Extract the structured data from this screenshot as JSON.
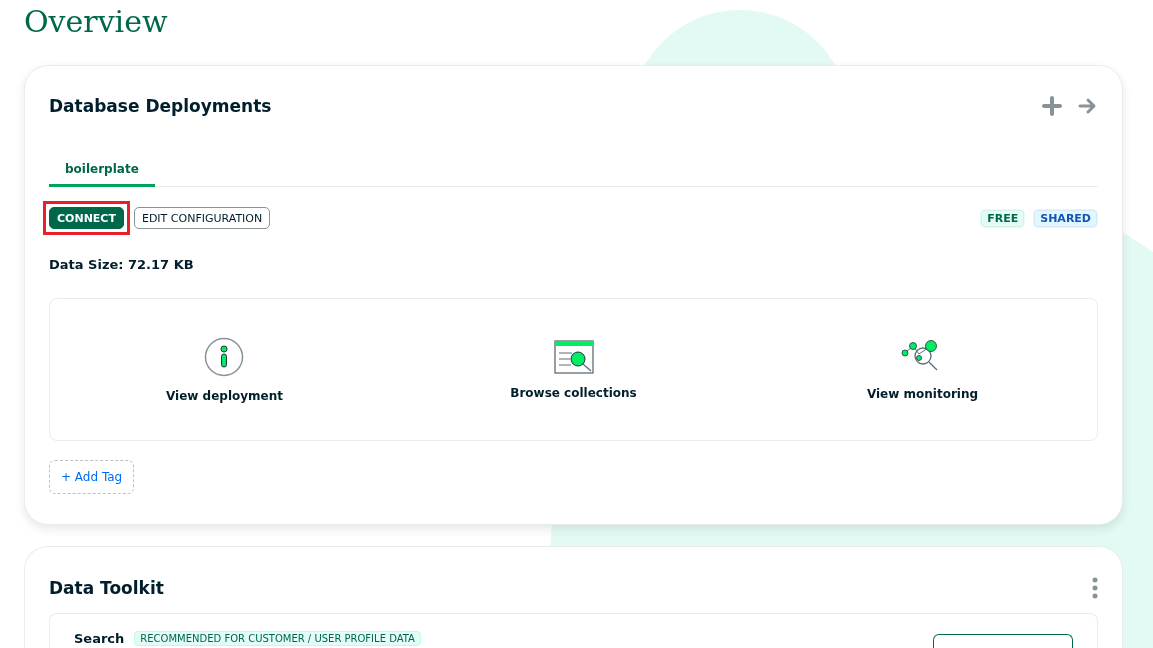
{
  "page_title": "Overview",
  "deployments": {
    "title": "Database Deployments",
    "tabs": [
      {
        "label": "boilerplate",
        "selected": true
      }
    ],
    "buttons": [
      {
        "label": "CONNECT",
        "kind": "primary",
        "highlighted": true
      },
      {
        "label": "EDIT CONFIGURATION",
        "kind": "secondary",
        "highlighted": false
      }
    ],
    "badges": [
      {
        "label": "FREE",
        "color": "#e3fcf7"
      },
      {
        "label": "SHARED",
        "color": "#e1f7ff"
      }
    ],
    "data_size": "Data Size: 72.17 KB",
    "actions": [
      {
        "label": "View deployment",
        "kind": "info"
      },
      {
        "label": "Browse collections",
        "kind": "browse"
      },
      {
        "label": "View monitoring",
        "kind": "monitor"
      }
    ],
    "add_tag": "+ Add Tag"
  },
  "toolkit": {
    "title": "Data Toolkit",
    "row_title": "Search",
    "row_badge": "RECOMMENDED FOR CUSTOMER / USER PROFILE DATA"
  }
}
